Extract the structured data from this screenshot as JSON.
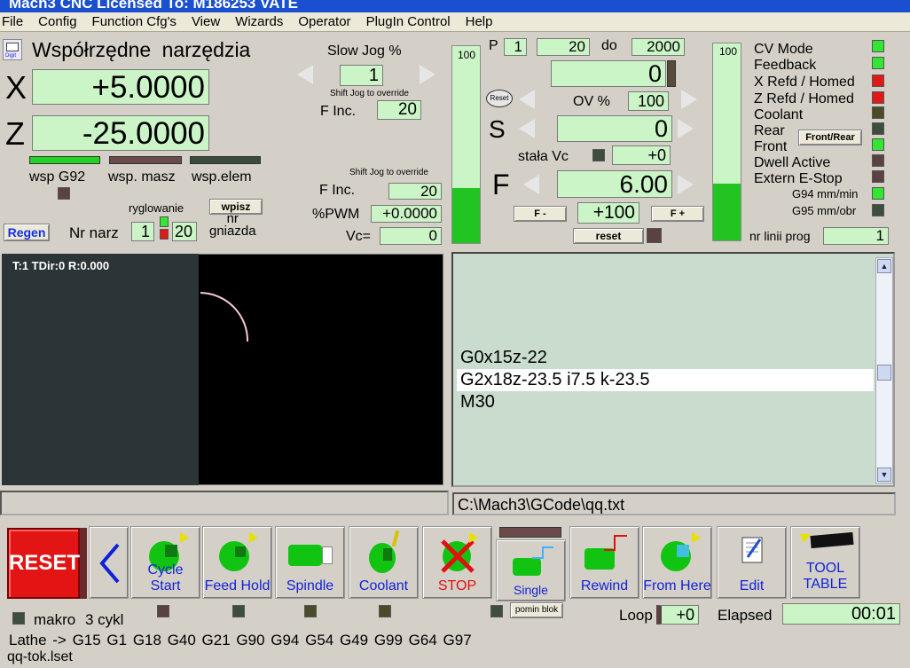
{
  "window": {
    "title": "Mach3 CNC  Licensed To: M186253 VATE"
  },
  "menu": [
    "File",
    "Config",
    "Function Cfg's",
    "View",
    "Wizards",
    "Operator",
    "PlugIn Control",
    "Help"
  ],
  "dro": {
    "title": "Współrzędne narzędzia",
    "x_label": "X",
    "x_value": "+5.0000",
    "z_label": "Z",
    "z_value": "-25.0000",
    "wsp_g92": "wsp G92",
    "wsp_masz": "wsp. masz",
    "wsp_elem": "wsp.elem",
    "ryglowanie": "ryglowanie",
    "wpisz": "wpisz",
    "regen": "Regen",
    "nr_narz": "Nr narz",
    "nr_narz_value": "1",
    "nr_gniazda_value": "20",
    "nr_gniazda": "nr\ngniazda"
  },
  "jog": {
    "slow_jog": "Slow Jog %",
    "slow_jog_value": "1",
    "shift_jog_1": "Shift Jog to override",
    "finc_label": "F Inc.",
    "finc_value_1": "20",
    "shift_jog_2": "Shift Jog to override",
    "finc_value_2": "20",
    "pwm_label": "%PWM",
    "pwm_value": "+0.0000",
    "vc_label": "Vc=",
    "vc_value": "0"
  },
  "spindle": {
    "bar_left_max": "100",
    "bar_left_level": 0.28,
    "p_label": "P",
    "p_value": "1",
    "p_from": "20",
    "do_label": "do",
    "p_to": "2000",
    "top_value": "0",
    "reset_small": "Reset",
    "ov_label": "OV %",
    "ov_value": "100",
    "s_label": "S",
    "s_value": "0",
    "stala_vc": "stała Vc",
    "stala_vc_value": "+0",
    "f_label": "F",
    "f_value": "6.00",
    "f_minus": "F -",
    "f_override": "+100",
    "f_plus": "F +",
    "reset_btn": "reset",
    "bar_right_max": "100",
    "bar_right_level": 0.29
  },
  "status": {
    "cv_mode": "CV Mode",
    "feedback": "Feedback",
    "x_refd": "X Refd / Homed",
    "z_refd": "Z Refd / Homed",
    "coolant": "Coolant",
    "rear": "Rear",
    "front": "Front",
    "front_rear_btn": "Front/Rear",
    "dwell": "Dwell Active",
    "estop": "Extern E-Stop",
    "g94": "G94 mm/min",
    "g95": "G95 mm/obr",
    "nr_linii": "nr linii prog",
    "nr_linii_value": "1",
    "colors": {
      "green": "#33e633",
      "red": "#e01818"
    }
  },
  "toolpath": {
    "info": "T:1 TDir:0 R:0.000"
  },
  "gcode": {
    "lines": [
      "G0x15z-22",
      "G2x18z-23.5  i7.5  k-23.5",
      "M30"
    ],
    "current_line_index": 1,
    "file_path": "C:\\Mach3\\GCode\\qq.txt"
  },
  "toolbar": {
    "reset": "RESET",
    "cycle_start": "Cycle Start",
    "feed_hold": "Feed Hold",
    "spindle": "Spindle",
    "coolant": "Coolant",
    "stop": "STOP",
    "single": "Single",
    "rewind": "Rewind",
    "from_here": "From Here",
    "edit": "Edit",
    "tool_table": "TOOL\nTABLE",
    "pomin_blok": "pomin blok"
  },
  "footer": {
    "makro": "makro",
    "cykl": "3 cykl",
    "loop_label": "Loop",
    "loop_value": "+0",
    "elapsed_label": "Elapsed",
    "elapsed_value": "00:01",
    "modal": "Lathe -> G15  G1 G18 G40 G21 G90 G94 G54 G49 G99 G64 G97",
    "profile": "qq-tok.lset"
  }
}
